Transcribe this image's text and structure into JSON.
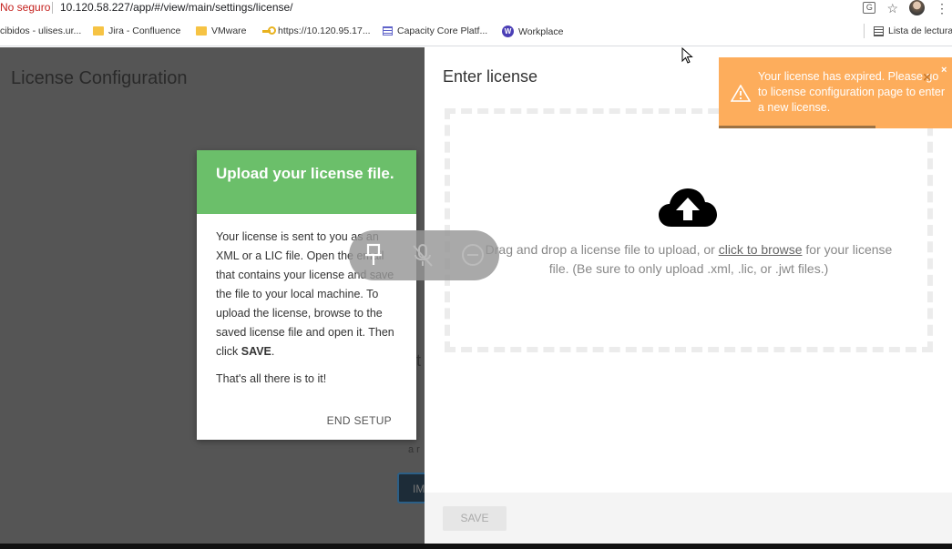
{
  "browser": {
    "insecure_label": "No seguro",
    "url": "10.120.58.227/app/#/view/main/settings/license/",
    "bookmarks": [
      {
        "label": "cibidos - ulises.ur...",
        "icon": "none"
      },
      {
        "label": "Jira - Confluence",
        "icon": "folder-icon"
      },
      {
        "label": "VMware",
        "icon": "folder-icon"
      },
      {
        "label": "https://10.120.95.17...",
        "icon": "key-icon"
      },
      {
        "label": "Capacity Core Platf...",
        "icon": "list-icon"
      },
      {
        "label": "Workplace",
        "icon": "workplace-icon"
      }
    ],
    "reading_list": "Lista de lectura"
  },
  "page": {
    "title": "License Configuration",
    "dim_fragments": [
      "t",
      "a r",
      "IM"
    ]
  },
  "tour": {
    "title": "Upload your license file.",
    "body_1_pre": "Your license is sent to you as an XML or a LIC file. Open the email that contains your license and save the file to your local machine. To upload the license, browse to the saved license file and open it. Then click ",
    "body_1_bold": "SAVE",
    "body_1_post": ".",
    "body_2": "That's all there is to it!",
    "end_label": "END SETUP"
  },
  "panel": {
    "title": "Enter license",
    "drop_pre": "Drag and drop a license file to upload, or ",
    "drop_link": "click to browse",
    "drop_post": " for your license file. (Be sure to only upload .xml, .lic, or .jwt files.)",
    "save_label": "SAVE"
  },
  "toast": {
    "message": "Your license has expired. Please go to license configuration page to enter a new license.",
    "close_glyph": "×",
    "dismiss_glyph": "×",
    "progress": 0.67
  },
  "colors": {
    "tour_header": "#6bbf6a",
    "toast_bg": "#fdad5c",
    "overlay_dim": "#555555"
  }
}
